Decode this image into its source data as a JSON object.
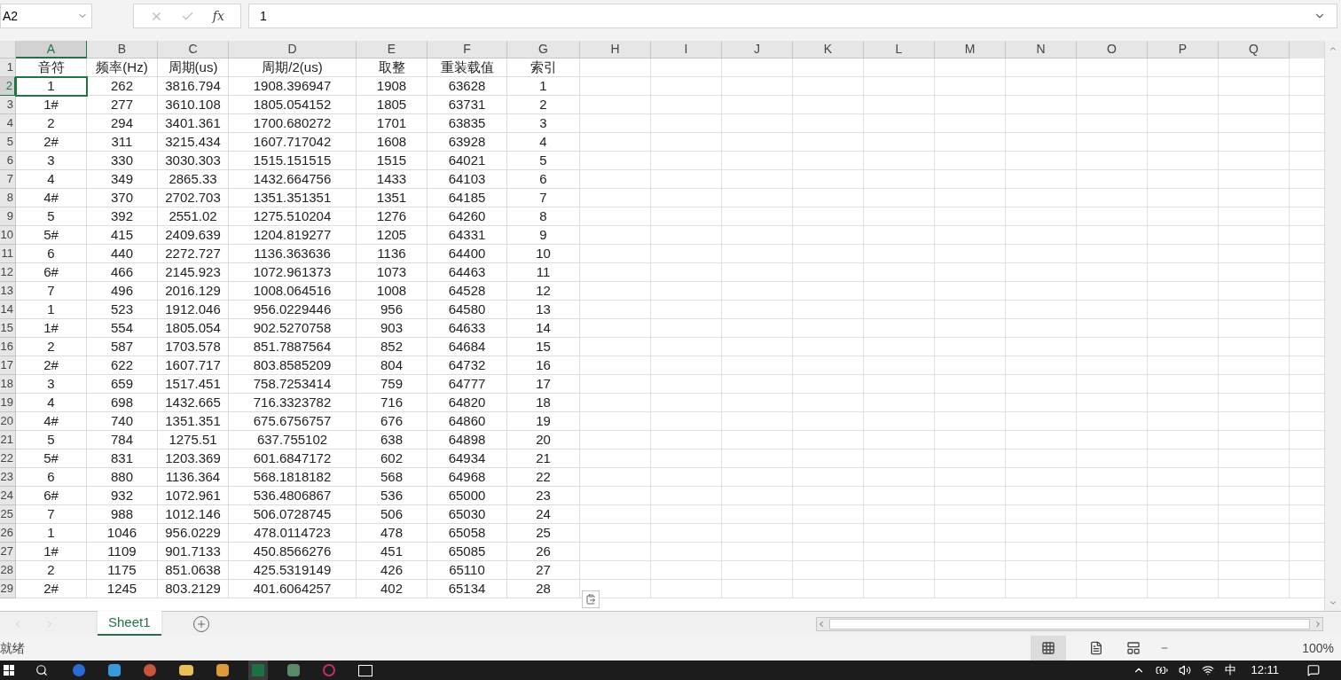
{
  "formula_bar": {
    "name_box": "A2",
    "function_button": "fx",
    "value": "1"
  },
  "columns": [
    {
      "label": "A",
      "selected": true
    },
    {
      "label": "B",
      "selected": false
    },
    {
      "label": "C",
      "selected": false
    },
    {
      "label": "D",
      "selected": false
    },
    {
      "label": "E",
      "selected": false
    },
    {
      "label": "F",
      "selected": false
    },
    {
      "label": "G",
      "selected": false
    },
    {
      "label": "H",
      "selected": false
    },
    {
      "label": "I",
      "selected": false
    },
    {
      "label": "J",
      "selected": false
    },
    {
      "label": "K",
      "selected": false
    },
    {
      "label": "L",
      "selected": false
    },
    {
      "label": "M",
      "selected": false
    },
    {
      "label": "N",
      "selected": false
    },
    {
      "label": "O",
      "selected": false
    },
    {
      "label": "P",
      "selected": false
    },
    {
      "label": "Q",
      "selected": false
    }
  ],
  "rows": [
    {
      "number": "1",
      "selected": false,
      "cells": [
        "音符",
        "频率(Hz)",
        "周期(us)",
        "周期/2(us)",
        "取整",
        "重装载值",
        "索引"
      ]
    },
    {
      "number": "2",
      "selected": true,
      "cells": [
        "1",
        "262",
        "3816.794",
        "1908.396947",
        "1908",
        "63628",
        "1"
      ]
    },
    {
      "number": "3",
      "selected": false,
      "cells": [
        "1#",
        "277",
        "3610.108",
        "1805.054152",
        "1805",
        "63731",
        "2"
      ]
    },
    {
      "number": "4",
      "selected": false,
      "cells": [
        "2",
        "294",
        "3401.361",
        "1700.680272",
        "1701",
        "63835",
        "3"
      ]
    },
    {
      "number": "5",
      "selected": false,
      "cells": [
        "2#",
        "311",
        "3215.434",
        "1607.717042",
        "1608",
        "63928",
        "4"
      ]
    },
    {
      "number": "6",
      "selected": false,
      "cells": [
        "3",
        "330",
        "3030.303",
        "1515.151515",
        "1515",
        "64021",
        "5"
      ]
    },
    {
      "number": "7",
      "selected": false,
      "cells": [
        "4",
        "349",
        "2865.33",
        "1432.664756",
        "1433",
        "64103",
        "6"
      ]
    },
    {
      "number": "8",
      "selected": false,
      "cells": [
        "4#",
        "370",
        "2702.703",
        "1351.351351",
        "1351",
        "64185",
        "7"
      ]
    },
    {
      "number": "9",
      "selected": false,
      "cells": [
        "5",
        "392",
        "2551.02",
        "1275.510204",
        "1276",
        "64260",
        "8"
      ]
    },
    {
      "number": "10",
      "selected": false,
      "cells": [
        "5#",
        "415",
        "2409.639",
        "1204.819277",
        "1205",
        "64331",
        "9"
      ]
    },
    {
      "number": "11",
      "selected": false,
      "cells": [
        "6",
        "440",
        "2272.727",
        "1136.363636",
        "1136",
        "64400",
        "10"
      ]
    },
    {
      "number": "12",
      "selected": false,
      "cells": [
        "6#",
        "466",
        "2145.923",
        "1072.961373",
        "1073",
        "64463",
        "11"
      ]
    },
    {
      "number": "13",
      "selected": false,
      "cells": [
        "7",
        "496",
        "2016.129",
        "1008.064516",
        "1008",
        "64528",
        "12"
      ]
    },
    {
      "number": "14",
      "selected": false,
      "cells": [
        "1",
        "523",
        "1912.046",
        "956.0229446",
        "956",
        "64580",
        "13"
      ]
    },
    {
      "number": "15",
      "selected": false,
      "cells": [
        "1#",
        "554",
        "1805.054",
        "902.5270758",
        "903",
        "64633",
        "14"
      ]
    },
    {
      "number": "16",
      "selected": false,
      "cells": [
        "2",
        "587",
        "1703.578",
        "851.7887564",
        "852",
        "64684",
        "15"
      ]
    },
    {
      "number": "17",
      "selected": false,
      "cells": [
        "2#",
        "622",
        "1607.717",
        "803.8585209",
        "804",
        "64732",
        "16"
      ]
    },
    {
      "number": "18",
      "selected": false,
      "cells": [
        "3",
        "659",
        "1517.451",
        "758.7253414",
        "759",
        "64777",
        "17"
      ]
    },
    {
      "number": "19",
      "selected": false,
      "cells": [
        "4",
        "698",
        "1432.665",
        "716.3323782",
        "716",
        "64820",
        "18"
      ]
    },
    {
      "number": "20",
      "selected": false,
      "cells": [
        "4#",
        "740",
        "1351.351",
        "675.6756757",
        "676",
        "64860",
        "19"
      ]
    },
    {
      "number": "21",
      "selected": false,
      "cells": [
        "5",
        "784",
        "1275.51",
        "637.755102",
        "638",
        "64898",
        "20"
      ]
    },
    {
      "number": "22",
      "selected": false,
      "cells": [
        "5#",
        "831",
        "1203.369",
        "601.6847172",
        "602",
        "64934",
        "21"
      ]
    },
    {
      "number": "23",
      "selected": false,
      "cells": [
        "6",
        "880",
        "1136.364",
        "568.1818182",
        "568",
        "64968",
        "22"
      ]
    },
    {
      "number": "24",
      "selected": false,
      "cells": [
        "6#",
        "932",
        "1072.961",
        "536.4806867",
        "536",
        "65000",
        "23"
      ]
    },
    {
      "number": "25",
      "selected": false,
      "cells": [
        "7",
        "988",
        "1012.146",
        "506.0728745",
        "506",
        "65030",
        "24"
      ]
    },
    {
      "number": "26",
      "selected": false,
      "cells": [
        "1",
        "1046",
        "956.0229",
        "478.0114723",
        "478",
        "65058",
        "25"
      ]
    },
    {
      "number": "27",
      "selected": false,
      "cells": [
        "1#",
        "1109",
        "901.7133",
        "450.8566276",
        "451",
        "65085",
        "26"
      ]
    },
    {
      "number": "28",
      "selected": false,
      "cells": [
        "2",
        "1175",
        "851.0638",
        "425.5319149",
        "426",
        "65110",
        "27"
      ]
    },
    {
      "number": "29",
      "selected": false,
      "cells": [
        "2#",
        "1245",
        "803.2129",
        "401.6064257",
        "402",
        "65134",
        "28"
      ]
    }
  ],
  "sheet_tabs": [
    {
      "label": "Sheet1",
      "selected": true
    }
  ],
  "status_bar": {
    "status": "就绪",
    "zoom": "100%"
  },
  "taskbar": {
    "input_method": "中",
    "clock": "12:11"
  }
}
